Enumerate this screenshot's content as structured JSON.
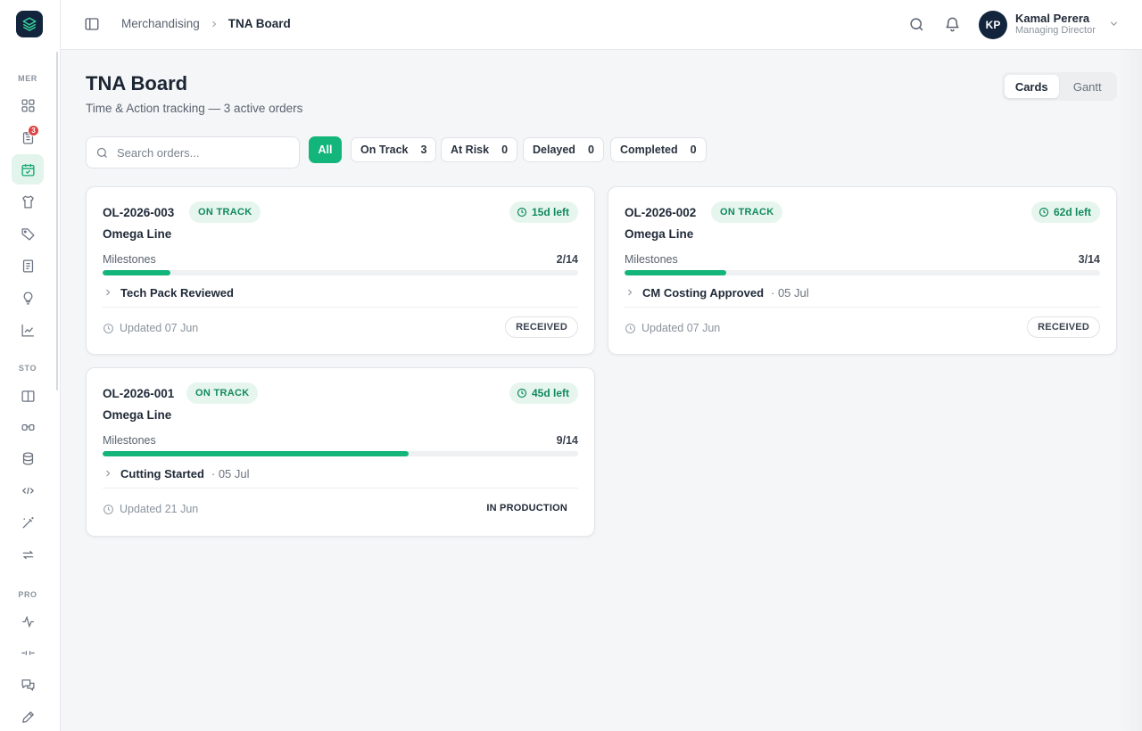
{
  "sidebar": {
    "sections": [
      {
        "label": "MER"
      },
      {
        "label": "STO"
      },
      {
        "label": "PRO"
      }
    ],
    "badge_count": "3",
    "items": [
      {
        "icon": "dashboard-grid-icon"
      },
      {
        "icon": "clipboard-list-icon"
      },
      {
        "icon": "calendar-check-icon"
      },
      {
        "icon": "shirt-icon"
      },
      {
        "icon": "tag-icon"
      },
      {
        "icon": "document-lines-icon"
      },
      {
        "icon": "lightbulb-icon"
      },
      {
        "icon": "line-chart-icon"
      },
      {
        "icon": "book-open-icon"
      },
      {
        "icon": "binoculars-icon"
      },
      {
        "icon": "database-icon"
      },
      {
        "icon": "code-arrows-icon"
      },
      {
        "icon": "magic-wand-icon"
      },
      {
        "icon": "repeat-icon"
      },
      {
        "icon": "activity-pulse-icon"
      },
      {
        "icon": "git-commit-icon"
      },
      {
        "icon": "messages-icon"
      },
      {
        "icon": "pencil-icon"
      }
    ]
  },
  "topbar": {
    "breadcrumb": [
      "Merchandising",
      "TNA Board"
    ],
    "user": {
      "initials": "KP",
      "name": "Kamal Perera",
      "role": "Managing Director"
    }
  },
  "page": {
    "title": "TNA Board",
    "subtitle": "Time & Action tracking — 3 active orders",
    "view_toggle": [
      "Cards",
      "Gantt"
    ],
    "active_view": "Cards"
  },
  "search": {
    "placeholder": "Search orders..."
  },
  "filters": [
    {
      "label": "All",
      "count": null,
      "active": true
    },
    {
      "label": "On Track",
      "count": "3"
    },
    {
      "label": "At Risk",
      "count": "0"
    },
    {
      "label": "Delayed",
      "count": "0"
    },
    {
      "label": "Completed",
      "count": "0"
    }
  ],
  "colors": {
    "accent": "#13b57a",
    "navy": "#12253d",
    "badge": "#e04343"
  },
  "orders": [
    {
      "id": "OL-2026-003",
      "status": "ON TRACK",
      "days_left": "15d left",
      "line": "Omega Line",
      "milestones_label": "Milestones",
      "milestones": "2/14",
      "progress": 0.1429,
      "current_milestone": "Tech Pack Reviewed",
      "milestone_date": "",
      "updated": "Updated 07 Jun",
      "stage": "RECEIVED"
    },
    {
      "id": "OL-2026-002",
      "status": "ON TRACK",
      "days_left": "62d left",
      "line": "Omega Line",
      "milestones_label": "Milestones",
      "milestones": "3/14",
      "progress": 0.2143,
      "current_milestone": "CM Costing Approved",
      "milestone_date": "· 05 Jul",
      "updated": "Updated 07 Jun",
      "stage": "RECEIVED"
    },
    {
      "id": "OL-2026-001",
      "status": "ON TRACK",
      "days_left": "45d left",
      "line": "Omega Line",
      "milestones_label": "Milestones",
      "milestones": "9/14",
      "progress": 0.6429,
      "current_milestone": "Cutting Started",
      "milestone_date": "· 05 Jul",
      "updated": "Updated 21 Jun",
      "stage": "IN PRODUCTION"
    }
  ]
}
